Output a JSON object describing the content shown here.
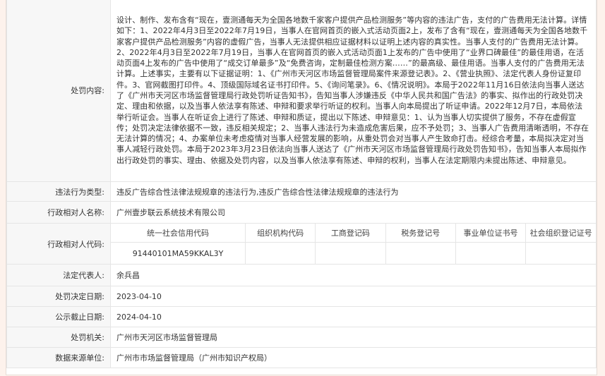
{
  "rows": {
    "content": {
      "label": "处罚内容:",
      "text": "设计、制作、发布含有“现在，壹测通每天为全国各地数千家客户提供产品检测服务”等内容的违法广告，支付的广告费用无法计算。详情如下：1、2022年4月3日至2022年7月19日，当事人在官网首页的嵌入式活动页面2上，发布了含有“现在，壹测通每天为全国各地数千家客户提供产品检测服务”内容的虚假广告，当事人无法提供相应证据材料以证明上述内容的真实性。当事人支付的广告费用无法计算。2、2022年4月3日至2022年7月19日，当事人在官网首页的嵌入式活动页面1上发布的广告中使用了“业界口碑最佳”的最佳用语，在活动页面4上发布的广告中使用了“成交订单最多”及“免费咨询，定制最佳检测方案……”的最高级、最佳用语。当事人支付的广告费用无法计算。上述事实，主要有以下证据证明：1、《广州市天河区市场监督管理局案件来源登记表》。2、《营业执照》、法定代表人身份证复印件。3、官网截图打印件。4、顶级国际域名证书打印件。5、《询问笔录》。6、《情况说明》。本局于2022年11月16日依法向当事人送达了《广州市天河区市场监督管理局行政处罚听证告知书》，告知当事人涉嫌违反《中华人民共和国广告法》的事实、拟作出的行政处罚决定、理由和依据，以及当事人依法享有陈述、申辩和要求举行听证的权利。当事人向本局提出了听证申请。2022年12月7日，本局依法举行听证会。当事人在听证会上进行了陈述、申辩和质证，提出以下陈述、申辩意见：1、认为当事人切实提供了服务，不存在虚假宣传；处罚决定法律依据不一致，违反相关规定；2、当事人违法行为未造成危害后果，应不予处罚；3、当事人广告费用清晰透明，不存在无法计算的情况；4、办案单位未考虑疫情对当事人经营发展的影响，从重处罚会对当事人产生致命打击。经综合考量，本局拟决定对当事人减轻行政处罚。本局于2023年3月23日依法向当事人送达了《广州市天河区市场监督管理局行政处罚告知书》，告知当事人本局拟作出行政处罚的事实、理由、依据及处罚内容，以及当事人依法享有陈述、申辩的权利，当事人在法定期限内未提出陈述、申辩意见。"
    },
    "violation_type": {
      "label": "违法行为类型:",
      "value": "违反广告综合性法律法规规章的违法行为,违反广告综合性法律法规规章的违法行为"
    },
    "party_name": {
      "label": "行政相对人名称:",
      "value": "广州壹步联云系统技术有限公司"
    },
    "party_code": {
      "label": "行政相对人代码:",
      "headers": [
        "统一社会信用代码",
        "组织机构代码",
        "工商登记码",
        "税务登记号",
        "事业单位证书号",
        "社会组织登记证号"
      ],
      "values": [
        "91440101MA59KKAL3Y",
        "",
        "",
        "",
        "",
        ""
      ]
    },
    "legal_rep": {
      "label": "法定代表人:",
      "value": "余兵昌"
    },
    "decision_date": {
      "label": "处罚决定日期:",
      "value": "2023-04-10"
    },
    "publicity_end": {
      "label": "公示截止日期:",
      "value": "2024-04-10"
    },
    "authority": {
      "label": "处罚机关:",
      "value": "广州市天河区市场监督管理局"
    },
    "source": {
      "label": "数据来源单位:",
      "value": "广州市市场监督管理局（广州市知识产权局）"
    }
  }
}
